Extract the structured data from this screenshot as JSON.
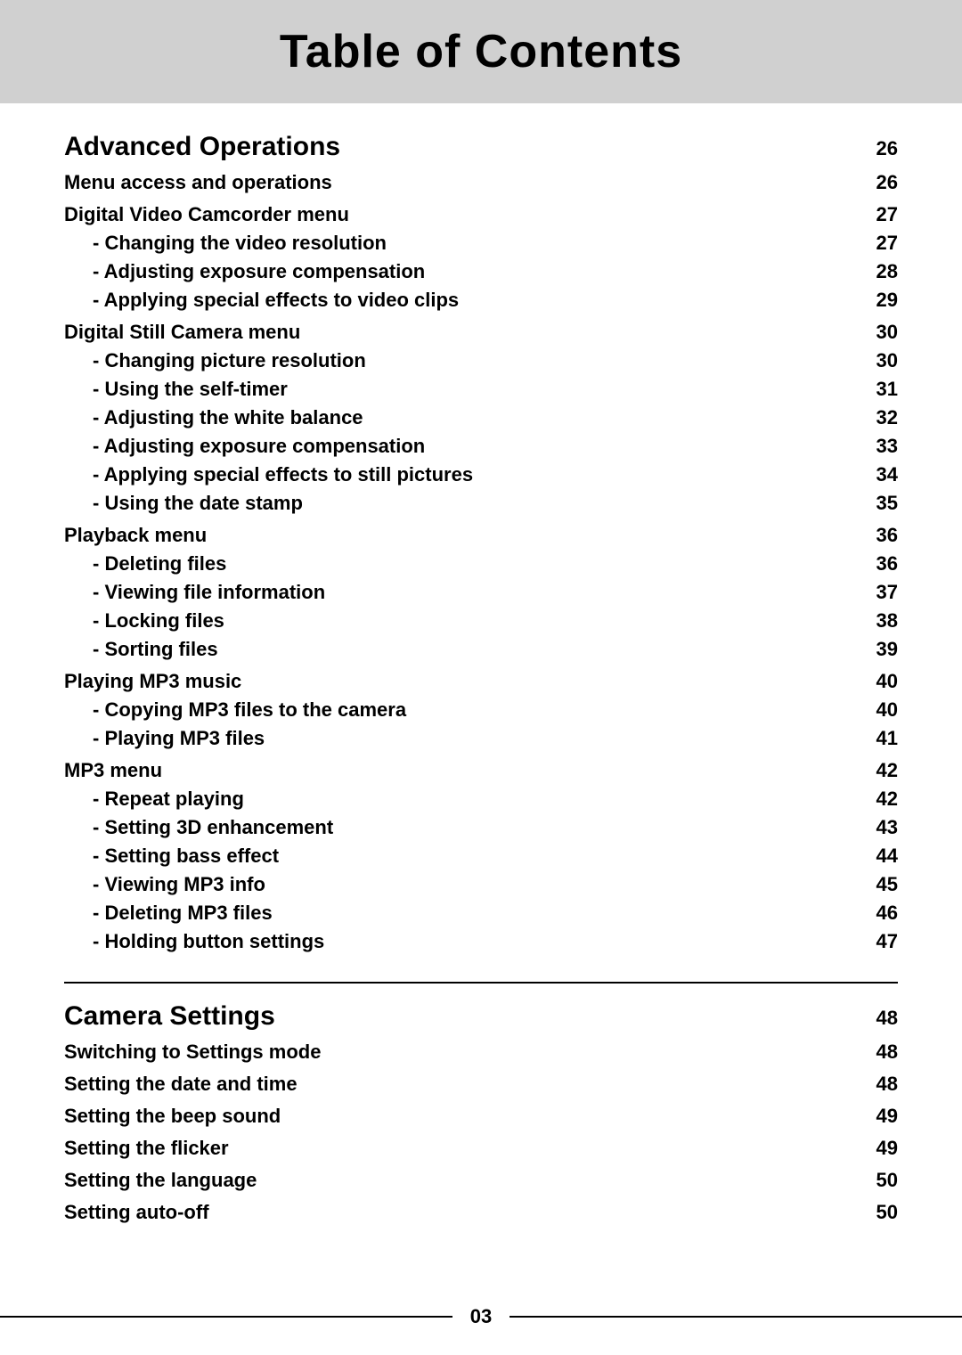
{
  "title": "Table of Contents",
  "sections": [
    {
      "type": "top-section",
      "label": "Advanced Operations",
      "page": "26"
    },
    {
      "type": "subsection-header",
      "label": "Menu access and operations",
      "page": "26"
    },
    {
      "type": "subsection-header",
      "label": "Digital Video Camcorder menu",
      "page": "27"
    },
    {
      "type": "sub-item",
      "label": "- Changing the video resolution",
      "page": "27"
    },
    {
      "type": "sub-item",
      "label": "- Adjusting exposure compensation",
      "page": "28"
    },
    {
      "type": "sub-item",
      "label": "- Applying special effects to video clips",
      "page": "29"
    },
    {
      "type": "subsection-header",
      "label": "Digital Still Camera menu",
      "page": "30"
    },
    {
      "type": "sub-item",
      "label": "- Changing picture resolution",
      "page": "30"
    },
    {
      "type": "sub-item",
      "label": "- Using the self-timer",
      "page": "31"
    },
    {
      "type": "sub-item",
      "label": "- Adjusting the white balance",
      "page": "32"
    },
    {
      "type": "sub-item",
      "label": "- Adjusting exposure compensation",
      "page": "33"
    },
    {
      "type": "sub-item",
      "label": "- Applying special effects to still pictures",
      "page": "34"
    },
    {
      "type": "sub-item",
      "label": "- Using the date stamp",
      "page": "35"
    },
    {
      "type": "subsection-header",
      "label": "Playback menu",
      "page": "36"
    },
    {
      "type": "sub-item",
      "label": "- Deleting files",
      "page": "36"
    },
    {
      "type": "sub-item",
      "label": "- Viewing file information",
      "page": "37"
    },
    {
      "type": "sub-item",
      "label": "- Locking files",
      "page": "38"
    },
    {
      "type": "sub-item",
      "label": "- Sorting files",
      "page": "39"
    },
    {
      "type": "subsection-header",
      "label": "Playing MP3 music",
      "page": "40"
    },
    {
      "type": "sub-item",
      "label": "- Copying MP3 files to the camera",
      "page": "40"
    },
    {
      "type": "sub-item",
      "label": "- Playing MP3 files",
      "page": "41"
    },
    {
      "type": "subsection-header",
      "label": "MP3 menu",
      "page": "42"
    },
    {
      "type": "sub-item",
      "label": "- Repeat playing",
      "page": "42"
    },
    {
      "type": "sub-item",
      "label": "- Setting 3D enhancement",
      "page": "43"
    },
    {
      "type": "sub-item",
      "label": "- Setting bass effect",
      "page": "44"
    },
    {
      "type": "sub-item",
      "label": "- Viewing MP3 info",
      "page": "45"
    },
    {
      "type": "sub-item",
      "label": "- Deleting MP3 files",
      "page": "46"
    },
    {
      "type": "sub-item",
      "label": "- Holding button settings",
      "page": "47"
    },
    {
      "type": "divider"
    },
    {
      "type": "top-section",
      "label": "Camera Settings",
      "page": "48"
    },
    {
      "type": "subsection-header",
      "label": "Switching to Settings mode",
      "page": "48"
    },
    {
      "type": "subsection-header",
      "label": "Setting the date and time",
      "page": "48"
    },
    {
      "type": "subsection-header",
      "label": "Setting the beep sound",
      "page": "49"
    },
    {
      "type": "subsection-header",
      "label": "Setting the flicker",
      "page": "49"
    },
    {
      "type": "subsection-header",
      "label": "Setting the language",
      "page": "50"
    },
    {
      "type": "subsection-header",
      "label": "Setting auto-off",
      "page": "50"
    }
  ],
  "footer": {
    "page_number": "03"
  }
}
